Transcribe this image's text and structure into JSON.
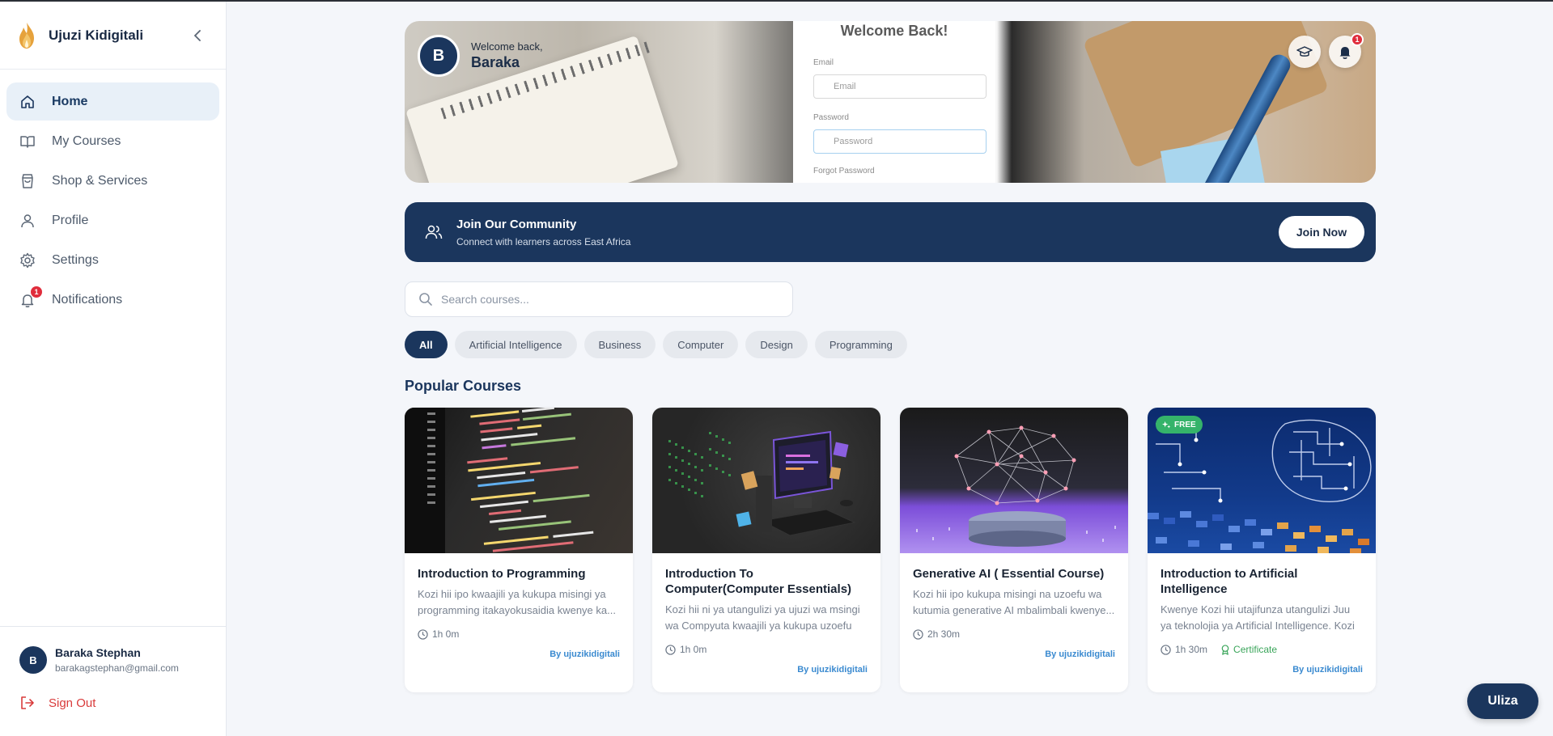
{
  "app": {
    "name": "Ujuzi Kidigitali"
  },
  "sidebar": {
    "items": [
      {
        "label": "Home",
        "icon": "home-icon",
        "active": true
      },
      {
        "label": "My Courses",
        "icon": "book-open-icon"
      },
      {
        "label": "Shop & Services",
        "icon": "shopping-bag-icon"
      },
      {
        "label": "Profile",
        "icon": "user-icon"
      },
      {
        "label": "Settings",
        "icon": "gear-icon"
      },
      {
        "label": "Notifications",
        "icon": "bell-icon",
        "badge": "1"
      }
    ],
    "user": {
      "initial": "B",
      "name": "Baraka Stephan",
      "email": "barakagstephan@gmail.com"
    },
    "signout_label": "Sign Out"
  },
  "hero": {
    "avatar_initial": "B",
    "welcome": "Welcome back,",
    "name": "Baraka",
    "image_text": {
      "title": "Welcome Back!",
      "email_label": "Email",
      "email_placeholder": "Email",
      "password_label": "Password",
      "password_placeholder": "Password",
      "forgot": "Forgot Password"
    },
    "notification_badge": "1"
  },
  "community": {
    "title": "Join Our Community",
    "subtitle": "Connect with learners across East Africa",
    "button": "Join Now"
  },
  "search": {
    "placeholder": "Search courses..."
  },
  "categories": [
    "All",
    "Artificial Intelligence",
    "Business",
    "Computer",
    "Design",
    "Programming"
  ],
  "section_title": "Popular Courses",
  "courses": [
    {
      "title": "Introduction to Programming",
      "description": "Kozi hii ipo kwaajili ya kukupa misingi ya programming itakayokusaidia kwenye ka...",
      "duration": "1h 0m",
      "author": "By ujuzikidigitali"
    },
    {
      "title": "Introduction To Computer(Computer Essentials)",
      "description": "Kozi hii ni ya utangulizi ya ujuzi wa msingi wa Compyuta kwaajili ya kukupa uzoefu n...",
      "duration": "1h 0m",
      "author": "By ujuzikidigitali"
    },
    {
      "title": "Generative AI ( Essential Course)",
      "description": "Kozi hii ipo kukupa misingi na uzoefu wa kutumia generative AI mbalimbali kwenye...",
      "duration": "2h 30m",
      "author": "By ujuzikidigitali"
    },
    {
      "title": "Introduction to Artificial Intelligence",
      "description": "Kwenye Kozi hii utajifunza utangulizi Juu ya teknolojia ya Artificial Intelligence. Kozi hi...",
      "duration": "1h 30m",
      "certificate": "Certificate",
      "badge": "FREE",
      "author": "By ujuzikidigitali"
    }
  ],
  "fab": {
    "label": "Uliza"
  },
  "colors": {
    "primary": "#1b365d",
    "accent_link": "#3a8ad0",
    "danger": "#e02d3c",
    "success": "#35b36a"
  }
}
